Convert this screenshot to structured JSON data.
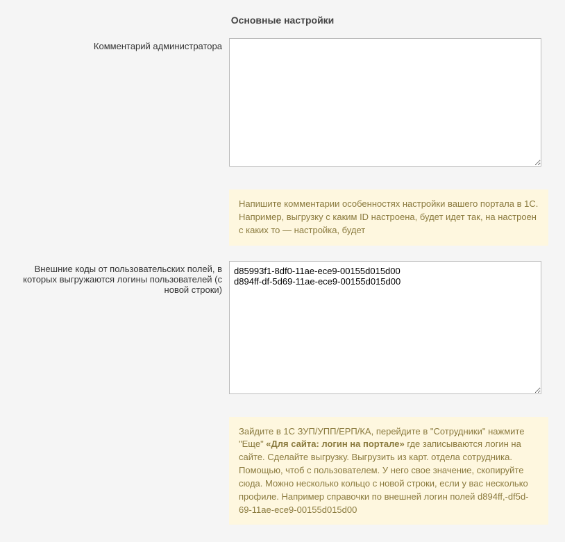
{
  "section_title": "Основные настройки",
  "fields": {
    "admin_comment": {
      "label": "Комментарий администратора",
      "value": "",
      "help": "Напишите комментарии особенностях настройки вашего портала в 1С. Например, выгрузку с каким ID настроена, будет идет так, на настроен с каких то — настройка, будет"
    },
    "external_codes": {
      "label": "Внешние коды от пользовательских полей, в которых выгружаются логины пользователей (с новой строки)",
      "value": "d85993f1-8df0-11ae-ece9-00155d015d00\nd894ff-df-5d69-11ae-ece9-00155d015d00",
      "help_text_before_bold": "Зайдите в 1С ЗУП/УПП/ЕРП/КА, перейдите в \"Сотрудники\" нажмите \"Еще\" ",
      "help_bold": "«Для сайта: логин на портале»",
      "help_text_after_bold": " где записываются логин на сайте. Сделайте выгрузку. Выгрузить из карт. отдела сотрудника. Помощью, чтоб с пользователем. У него свое значение, скопируйте сюда. Можно несколько кольцо с новой строки, если у вас несколько профиле.\nНапример справочки по внешней логин полей\nd894ff,-df5d-69-11ae-ece9-00155d015d00"
    }
  }
}
